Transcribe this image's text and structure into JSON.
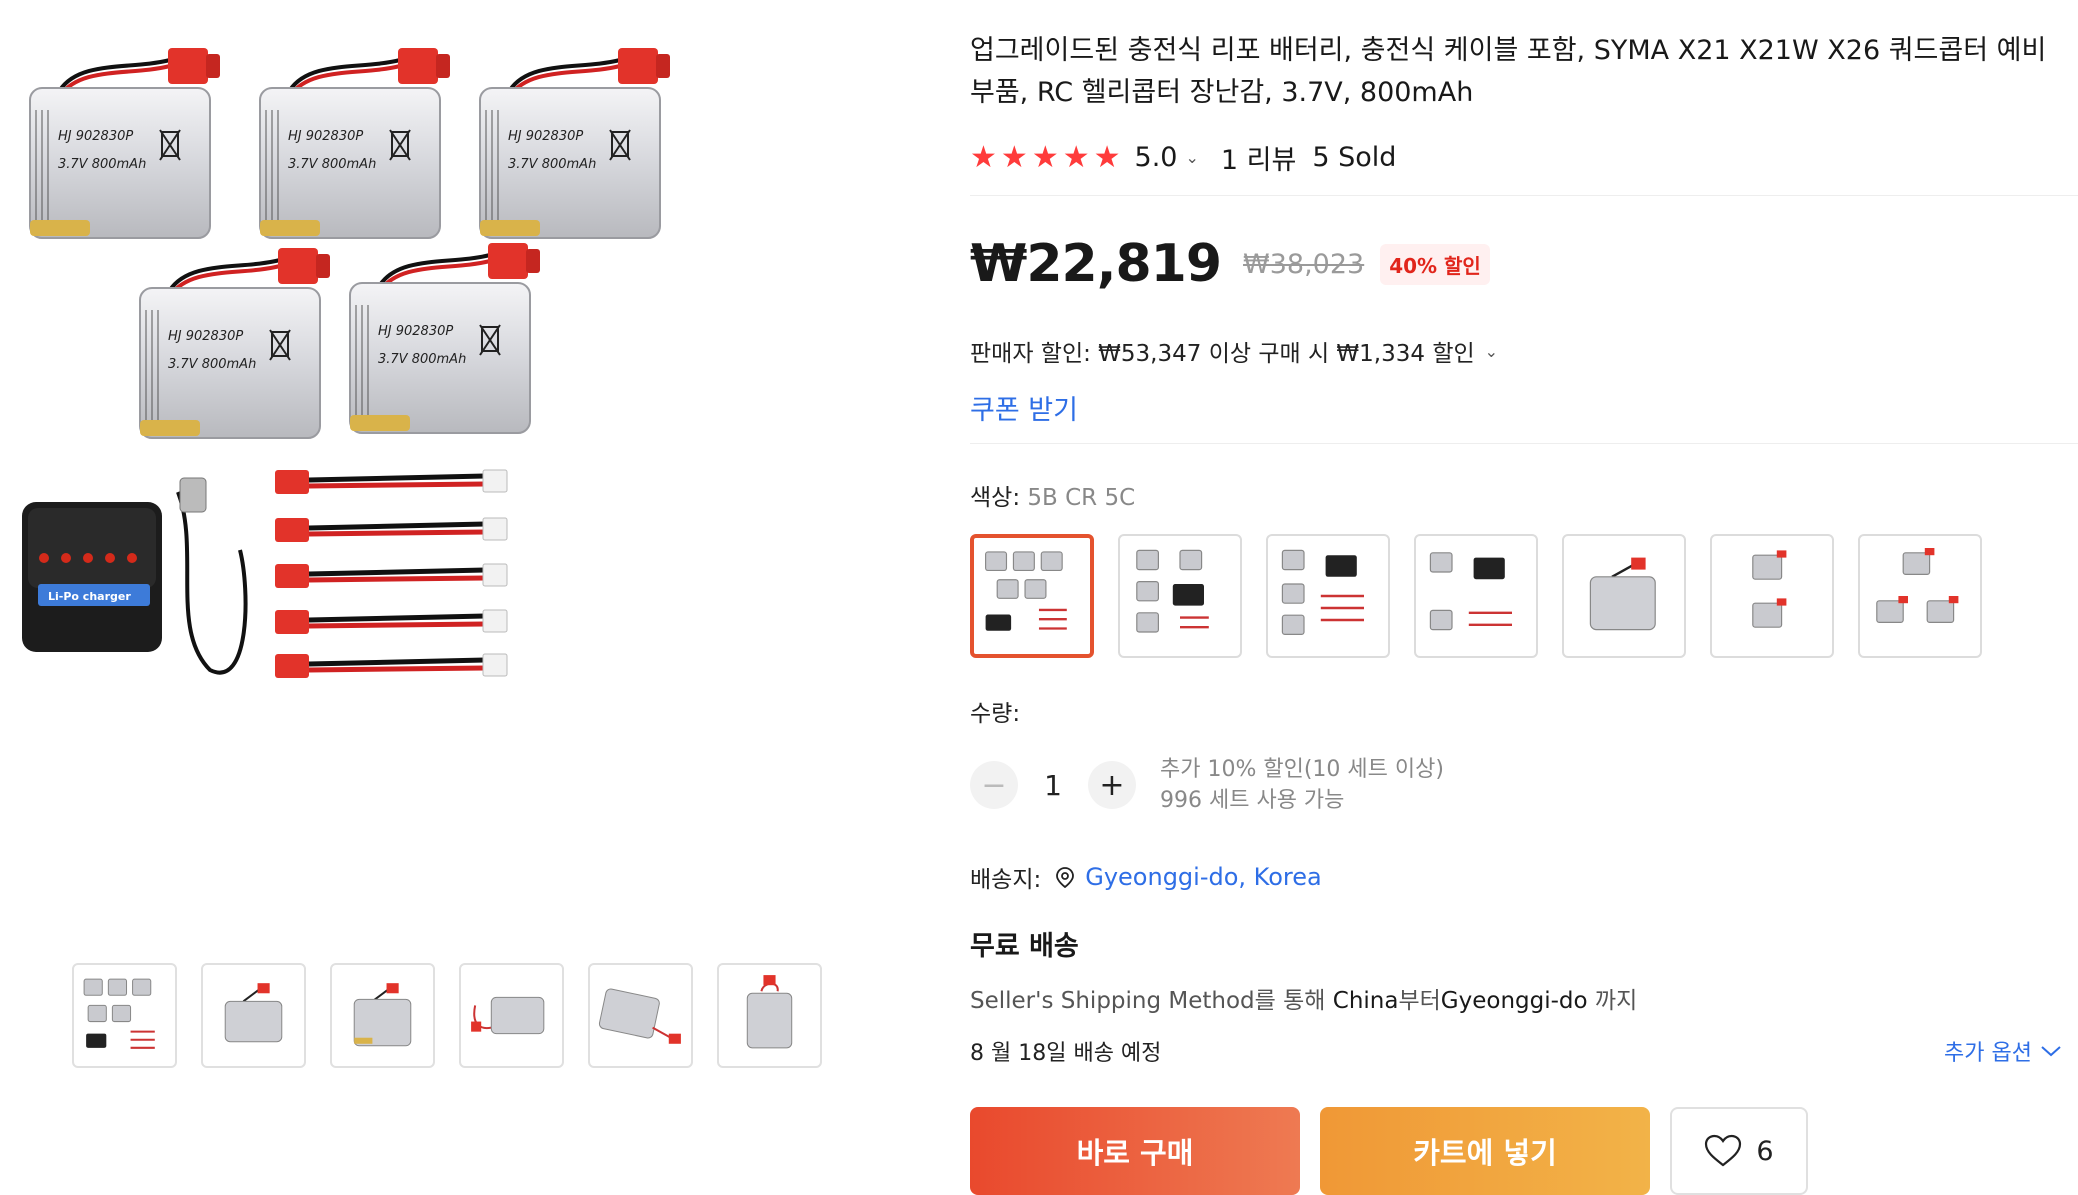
{
  "product": {
    "title": "업그레이드된 충전식 리포 배터리, 충전식 케이블 포함, SYMA X21 X21W X26 쿼드콥터 예비 부품, RC 헬리콥터 장난감, 3.7V, 800mAh",
    "rating": "5.0",
    "star_color": "#ff3b3b",
    "reviews": "1 리뷰",
    "sold": "5 Sold",
    "battery_label_line1": "HJ 902830P",
    "battery_label_line2": "3.7V 800mAh",
    "charger_label": "Li-Po charger"
  },
  "price": {
    "current": "₩22,819",
    "original": "₩38,023",
    "discount": "40% 할인"
  },
  "seller_discount": "판매자 할인: ₩53,347 이상 구매 시 ₩1,334 할인",
  "coupon_label": "쿠폰 받기",
  "color": {
    "label": "색상:",
    "value": "5B CR 5C",
    "selected_index": 0,
    "accent": "#e4522e"
  },
  "quantity": {
    "label": "수량:",
    "value": "1",
    "minus": "−",
    "plus": "+",
    "info_line1": "추가 10% 할인(10 세트 이상)",
    "info_line2": "996 세트 사용 가능"
  },
  "shipping": {
    "label": "배송지:",
    "location": "Gyeonggi-do, Korea",
    "free": "무료 배송",
    "method_pre": "Seller's Shipping Method를 통해 ",
    "method_from": "China",
    "method_mid": "부터",
    "method_to": "Gyeonggi-do",
    "method_post": " 까지",
    "delivery": "8 월 18일 배송 예정",
    "more_options": "추가 옵션"
  },
  "actions": {
    "buy_now": "바로 구매",
    "add_cart": "카트에 넣기",
    "wishlist_count": "6"
  },
  "icons": {
    "star": "star-icon",
    "location": "location-pin-icon",
    "heart": "heart-icon",
    "chevron": "chevron-down-icon"
  }
}
